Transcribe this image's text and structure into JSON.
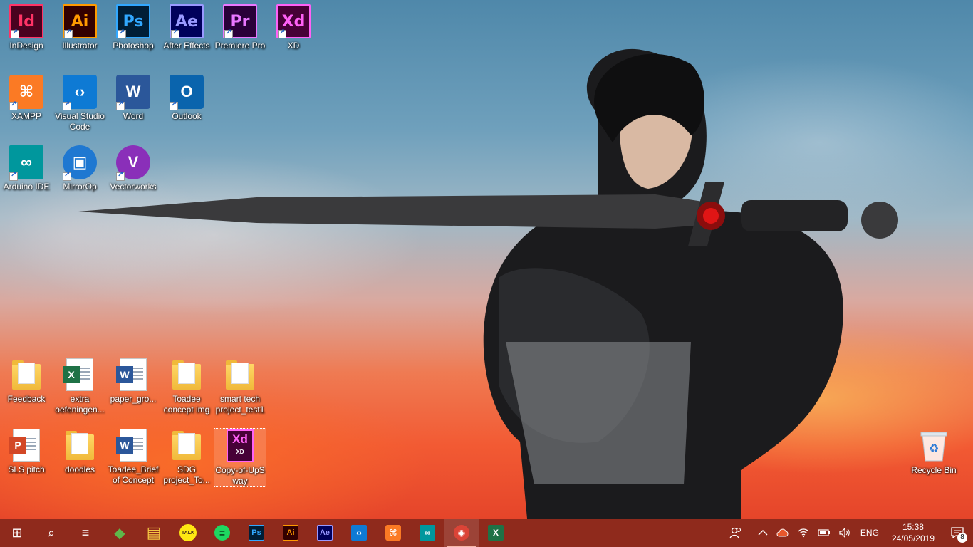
{
  "desktop": {
    "icons": [
      {
        "label": "InDesign",
        "glyph": "Id",
        "icon": "indesign-icon",
        "color": "#ff3366",
        "bg": "#49021f"
      },
      {
        "label": "Illustrator",
        "glyph": "Ai",
        "icon": "illustrator-icon",
        "color": "#ff9a00",
        "bg": "#330000"
      },
      {
        "label": "Photoshop",
        "glyph": "Ps",
        "icon": "photoshop-icon",
        "color": "#31a8ff",
        "bg": "#001e36"
      },
      {
        "label": "After Effects",
        "glyph": "Ae",
        "icon": "after-effects-icon",
        "color": "#9999ff",
        "bg": "#00005b"
      },
      {
        "label": "Premiere Pro",
        "glyph": "Pr",
        "icon": "premiere-pro-icon",
        "color": "#ea77ff",
        "bg": "#2a0039"
      },
      {
        "label": "XD",
        "glyph": "Xd",
        "icon": "xd-icon",
        "color": "#ff61f6",
        "bg": "#470137"
      },
      {
        "label": "XAMPP",
        "glyph": "⌘",
        "icon": "xampp-icon",
        "color": "#ffffff",
        "bg": "#fb7a24"
      },
      {
        "label": "Visual Studio Code",
        "glyph": "‹›",
        "icon": "vscode-icon",
        "color": "#ffffff",
        "bg": "#0e7ad4"
      },
      {
        "label": "Word",
        "glyph": "W",
        "icon": "word-icon",
        "color": "#ffffff",
        "bg": "#2b579a"
      },
      {
        "label": "Outlook",
        "glyph": "O",
        "icon": "outlook-icon",
        "color": "#ffffff",
        "bg": "#0a64ad"
      },
      {
        "label": "Arduino IDE",
        "glyph": "∞",
        "icon": "arduino-icon",
        "color": "#ffffff",
        "bg": "#00979d"
      },
      {
        "label": "MirrorOp",
        "glyph": "▣",
        "icon": "mirrorop-icon",
        "color": "#ffffff",
        "bg": "#1f78d1"
      },
      {
        "label": "Vectorworks",
        "glyph": "V",
        "icon": "vectorworks-icon",
        "color": "#ffffff",
        "bg": "#8a2fb9"
      }
    ],
    "files": [
      {
        "label": "Feedback",
        "kind": "folder",
        "icon": "folder-icon"
      },
      {
        "label": "extra oefeningen...",
        "kind": "excel",
        "icon": "excel-file-icon"
      },
      {
        "label": "paper_gro...",
        "kind": "word",
        "icon": "word-file-icon"
      },
      {
        "label": "Toadee concept img",
        "kind": "folder",
        "icon": "folder-icon"
      },
      {
        "label": "smart tech project_test1",
        "kind": "folder",
        "icon": "folder-icon"
      },
      {
        "label": "SLS pitch",
        "kind": "powerpoint",
        "icon": "powerpoint-file-icon"
      },
      {
        "label": "doodles",
        "kind": "folder",
        "icon": "folder-icon"
      },
      {
        "label": "Toadee_Brief of Concept",
        "kind": "word",
        "icon": "word-file-icon"
      },
      {
        "label": "SDG project_To...",
        "kind": "folder",
        "icon": "folder-icon"
      },
      {
        "label": "Copy-of-UpS way",
        "kind": "xd",
        "icon": "xd-file-icon"
      }
    ],
    "recycle_bin": {
      "label": "Recycle Bin"
    }
  },
  "taskbar": {
    "apps": [
      {
        "name": "start",
        "glyph": "⊞",
        "icon": "windows-start-icon"
      },
      {
        "name": "search",
        "glyph": "⌕",
        "icon": "search-icon"
      },
      {
        "name": "task-view",
        "glyph": "≡",
        "icon": "task-view-icon"
      },
      {
        "name": "sims",
        "glyph": "◆",
        "icon": "sims-icon"
      },
      {
        "name": "file-explorer",
        "glyph": "▤",
        "icon": "file-explorer-icon"
      },
      {
        "name": "kakaotalk",
        "glyph": "TALK",
        "icon": "kakaotalk-icon"
      },
      {
        "name": "spotify",
        "glyph": "≡",
        "icon": "spotify-icon"
      },
      {
        "name": "photoshop",
        "glyph": "Ps",
        "icon": "photoshop-icon"
      },
      {
        "name": "illustrator",
        "glyph": "Ai",
        "icon": "illustrator-icon"
      },
      {
        "name": "after-effects",
        "glyph": "Ae",
        "icon": "after-effects-icon"
      },
      {
        "name": "vscode",
        "glyph": "‹›",
        "icon": "vscode-icon"
      },
      {
        "name": "xampp",
        "glyph": "⌘",
        "icon": "xampp-icon"
      },
      {
        "name": "arduino",
        "glyph": "∞",
        "icon": "arduino-icon"
      },
      {
        "name": "chrome",
        "glyph": "◉",
        "icon": "chrome-icon"
      },
      {
        "name": "excel",
        "glyph": "X",
        "icon": "excel-icon"
      }
    ],
    "tray": {
      "language": "ENG",
      "time": "15:38",
      "date": "24/05/2019",
      "notification_count": "8"
    }
  }
}
